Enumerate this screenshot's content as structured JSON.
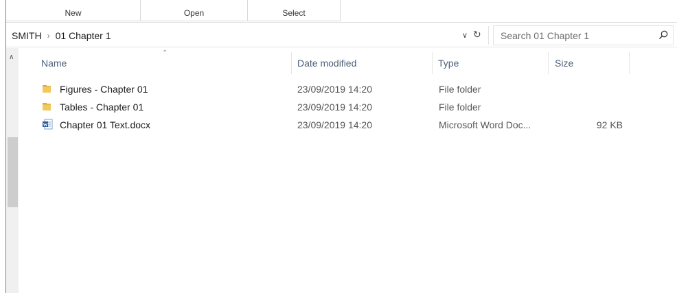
{
  "ribbon": {
    "groups": [
      "New",
      "Open",
      "Select"
    ]
  },
  "address": {
    "breadcrumb": [
      "SMITH",
      "01 Chapter 1"
    ],
    "separator": "›",
    "search_placeholder": "Search 01 Chapter 1"
  },
  "columns": {
    "name": "Name",
    "date": "Date modified",
    "type": "Type",
    "size": "Size"
  },
  "files": [
    {
      "name": "Figures - Chapter 01",
      "date": "23/09/2019 14:20",
      "type": "File folder",
      "size": "",
      "icon": "folder-icon"
    },
    {
      "name": "Tables - Chapter 01",
      "date": "23/09/2019 14:20",
      "type": "File folder",
      "size": "",
      "icon": "folder-icon"
    },
    {
      "name": "Chapter 01 Text.docx",
      "date": "23/09/2019 14:20",
      "type": "Microsoft Word Doc...",
      "size": "92 KB",
      "icon": "word-document-icon"
    }
  ],
  "colors": {
    "folder": "#e8b84a",
    "word": "#2b579a",
    "header_text": "#4c607a"
  }
}
